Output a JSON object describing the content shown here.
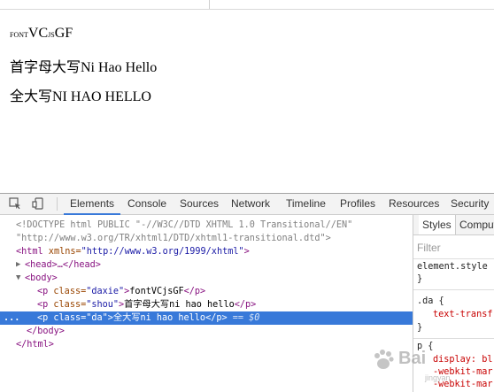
{
  "page": {
    "line1_small": "FONT",
    "line1_mid": "VC",
    "line1_small2": "JS",
    "line1_end": "GF",
    "line2": "首字母大写Ni Hao Hello",
    "line3": "全大写NI HAO HELLO"
  },
  "devtools": {
    "tabs": [
      "Elements",
      "Console",
      "Sources",
      "Network",
      "Timeline",
      "Profiles",
      "Resources",
      "Security"
    ],
    "active_tab": "Elements",
    "dom": {
      "doctype1": "<!DOCTYPE html PUBLIC \"-//W3C//DTD XHTML 1.0 Transitional//EN\"",
      "doctype2": "\"http://www.w3.org/TR/xhtml1/DTD/xhtml1-transitional.dtd\">",
      "html_open": "<html",
      "html_attr": " xmlns=",
      "html_val": "\"http://www.w3.org/1999/xhtml\"",
      "html_close_bracket": ">",
      "head": "<head>…</head>",
      "body_open": "<body>",
      "p_open": "<p",
      "class_attr": " class=",
      "p1_class": "\"daxie\"",
      "p1_text": "fontVCjsGF",
      "p2_class": "\"shou\"",
      "p2_text": "首字母大写ni hao hello",
      "p3_class": "\"da\"",
      "p3_text": "全大写ni hao hello",
      "p_close": "</p>",
      "gt": ">",
      "dollar": " == $0",
      "dots": "...",
      "body_close": "</body>",
      "html_close": "</html>"
    },
    "styles": {
      "tabs": [
        "Styles",
        "Comput"
      ],
      "filter_placeholder": "Filter",
      "element_style": "element.style",
      "close_brace": "}",
      "rule_da": ".da {",
      "rule_da_prop": "text-transf",
      "rule_p": "p {",
      "prop_display": "display: bl",
      "prop_webkit1": "-webkit-mar",
      "prop_webkit2": "-webkit-mar"
    }
  },
  "watermark": {
    "text": "Bai",
    "sub": "jingyan"
  }
}
